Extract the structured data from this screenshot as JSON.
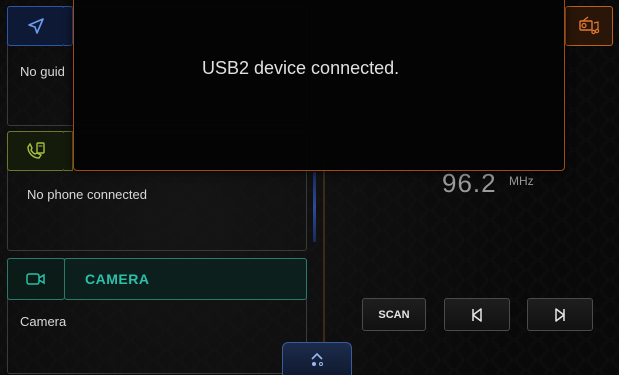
{
  "navigation": {
    "icon": "navigation-arrow-icon",
    "status": "No guid"
  },
  "phone": {
    "icon": "phone-device-icon",
    "status": "No phone connected"
  },
  "camera": {
    "icon": "camera-icon",
    "title": "CAMERA",
    "status": "Camera"
  },
  "radio": {
    "icon": "radio-music-icon",
    "frequency": "96.2",
    "unit": "MHz",
    "controls": {
      "scan_label": "SCAN",
      "prev_icon": "seek-previous-icon",
      "next_icon": "seek-next-icon"
    }
  },
  "drawer": {
    "icon": "chevron-up-icon"
  },
  "notification": {
    "message": "USB2 device connected."
  },
  "colors": {
    "navigation_accent": "#2b57a8",
    "phone_accent": "#6a7a2a",
    "camera_accent": "#2bc0a8",
    "radio_accent": "#c06020",
    "popup_border": "#a04a18"
  }
}
